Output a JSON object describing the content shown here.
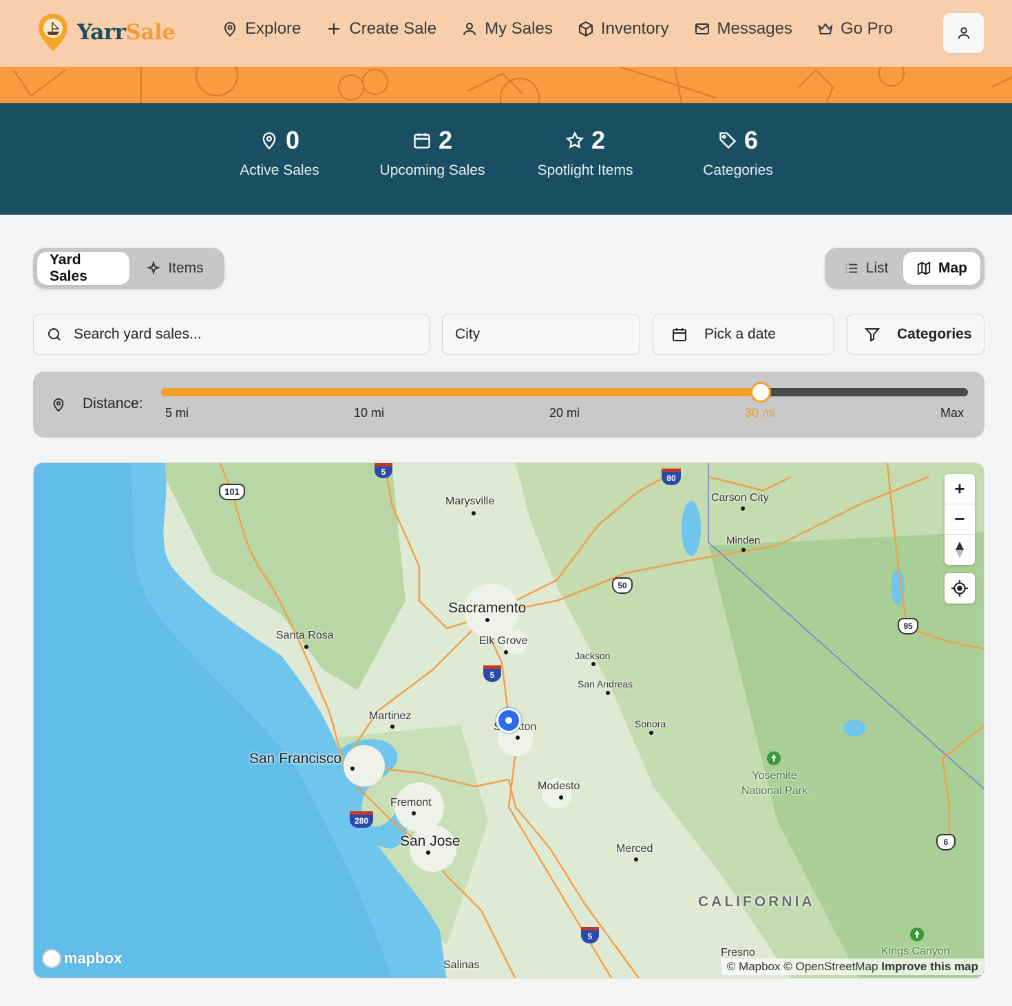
{
  "brand": {
    "part1": "Yarr",
    "part2": "Sale"
  },
  "nav": [
    {
      "label": "Explore",
      "icon": "map-pin-icon"
    },
    {
      "label": "Create Sale",
      "icon": "plus-icon"
    },
    {
      "label": "My Sales",
      "icon": "user-icon"
    },
    {
      "label": "Inventory",
      "icon": "box-icon"
    },
    {
      "label": "Messages",
      "icon": "mail-icon"
    },
    {
      "label": "Go Pro",
      "icon": "crown-icon"
    }
  ],
  "stats": [
    {
      "value": "0",
      "label": "Active Sales",
      "icon": "map-pin-icon"
    },
    {
      "value": "2",
      "label": "Upcoming Sales",
      "icon": "calendar-icon"
    },
    {
      "value": "2",
      "label": "Spotlight Items",
      "icon": "star-icon"
    },
    {
      "value": "6",
      "label": "Categories",
      "icon": "tag-icon"
    }
  ],
  "mode_toggle": {
    "yard_sales": "Yard Sales",
    "items": "Items",
    "active": "Yard Sales"
  },
  "view_toggle": {
    "list": "List",
    "map": "Map",
    "active": "Map"
  },
  "filters": {
    "search_placeholder": "Search yard sales...",
    "city_placeholder": "City",
    "date_label": "Pick a date",
    "categories_label": "Categories"
  },
  "distance": {
    "label": "Distance:",
    "ticks": [
      "5 mi",
      "10 mi",
      "20 mi",
      "30 mi",
      "Max"
    ],
    "selected": "30 mi",
    "fraction": 0.743
  },
  "map": {
    "places": {
      "marysville": "Marysville",
      "carson_city": "Carson City",
      "minden": "Minden",
      "sacramento": "Sacramento",
      "santa_rosa": "Santa Rosa",
      "elk_grove": "Elk Grove",
      "jackson": "Jackson",
      "san_andreas": "San Andreas",
      "martinez": "Martinez",
      "stockton": "Stockton",
      "sonora": "Sonora",
      "san_francisco": "San Francisco",
      "modesto": "Modesto",
      "fremont": "Fremont",
      "san_jose": "San Jose",
      "merced": "Merced",
      "california": "CALIFORNIA",
      "yosemite": "Yosemite National Park",
      "fresno": "Fresno",
      "kings_canyon": "Kings Canyon",
      "salinas": "Salinas"
    },
    "shields": {
      "us101": "101",
      "i5": "5",
      "i80": "80",
      "us50": "50",
      "us95": "95",
      "i280": "280",
      "us6": "6"
    },
    "mapbox_logo": "mapbox",
    "attribution": "© Mapbox © OpenStreetMap",
    "improve": "Improve this map",
    "colors": {
      "water": "#6fc5ee",
      "land": "#dfead5",
      "road": "#f0a04b"
    }
  }
}
